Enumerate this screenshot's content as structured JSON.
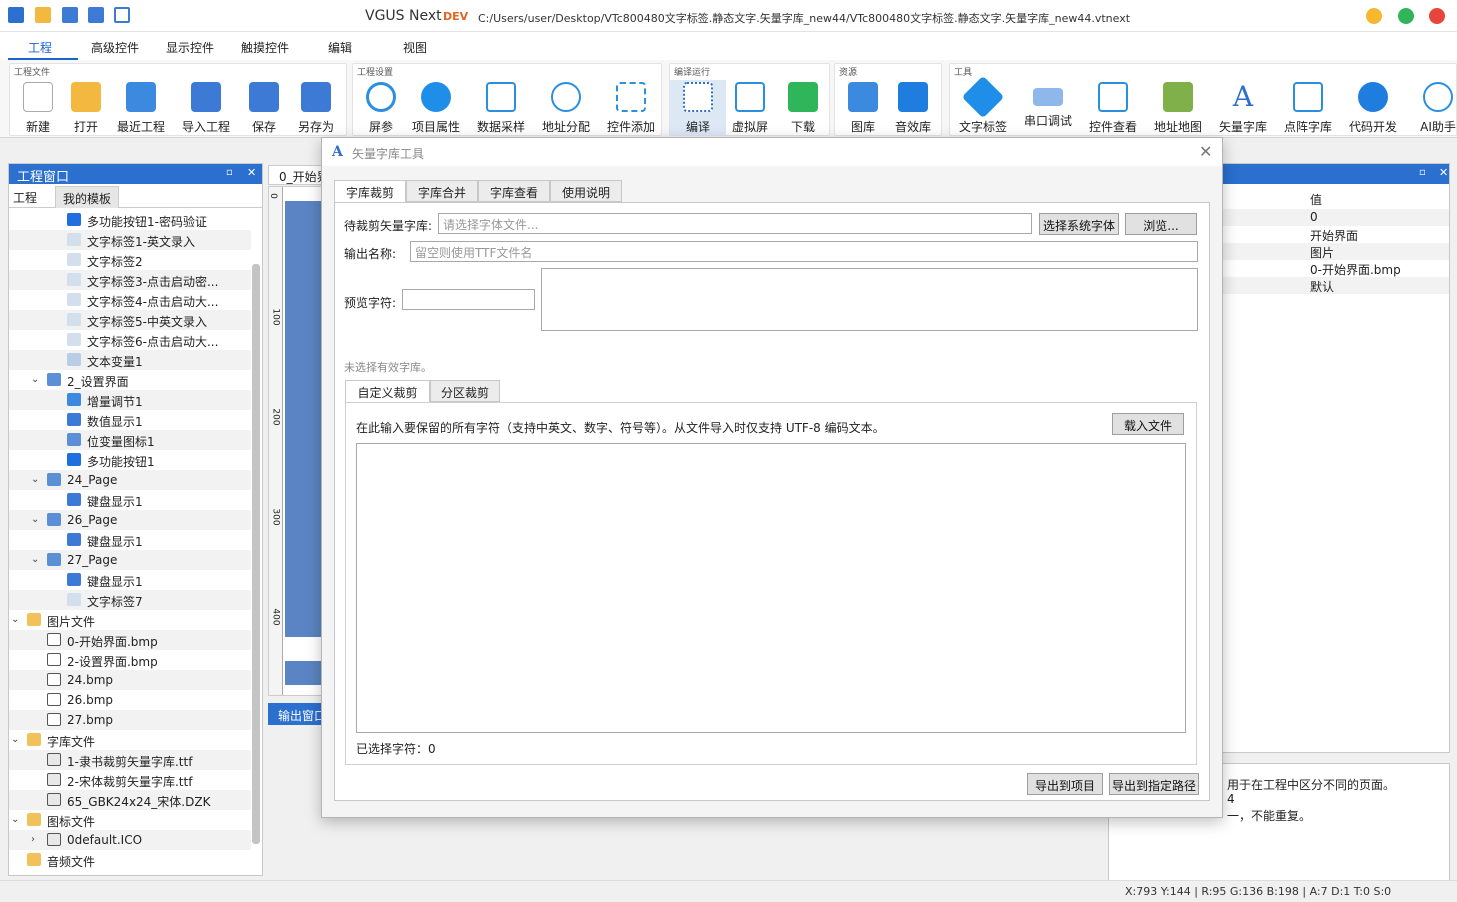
{
  "app": {
    "title": "VGUS Next",
    "edition": "DEV",
    "path": "C:/Users/user/Desktop/VTc800480文字标签.静态文字.矢量字库_new44/VTc800480文字标签.静态文字.矢量字库_new44.vtnext"
  },
  "menu": [
    "工程",
    "高级控件",
    "显示控件",
    "触摸控件",
    "编辑",
    "视图"
  ],
  "ribbon": {
    "groups": [
      {
        "label": "工程文件",
        "buttons": [
          "新建",
          "打开",
          "最近工程",
          "导入工程",
          "保存",
          "另存为"
        ]
      },
      {
        "label": "工程设置",
        "buttons": [
          "屏参",
          "项目属性",
          "数据采样",
          "地址分配",
          "控件添加"
        ]
      },
      {
        "label": "编译运行",
        "buttons": [
          "编译",
          "虚拟屏",
          "下载"
        ]
      },
      {
        "label": "资源",
        "buttons": [
          "图库",
          "音效库"
        ]
      },
      {
        "label": "工具",
        "buttons": [
          "文字标签",
          "串口调试",
          "控件查看",
          "地址地图",
          "矢量字库",
          "点阵字库",
          "代码开发",
          "AI助手"
        ]
      }
    ]
  },
  "project_panel": {
    "title": "工程窗口",
    "tabs": [
      "工程",
      "我的模板"
    ],
    "tree": [
      {
        "indent": 3,
        "icon": "button-icon",
        "label": "多功能按钮1-密码验证"
      },
      {
        "indent": 3,
        "icon": "text-icon",
        "label": "文字标签1-英文录入"
      },
      {
        "indent": 3,
        "icon": "text-icon",
        "label": "文字标签2"
      },
      {
        "indent": 3,
        "icon": "text-icon",
        "label": "文字标签3-点击启动密..."
      },
      {
        "indent": 3,
        "icon": "text-icon",
        "label": "文字标签4-点击启动大..."
      },
      {
        "indent": 3,
        "icon": "text-icon",
        "label": "文字标签5-中英文录入"
      },
      {
        "indent": 3,
        "icon": "text-icon",
        "label": "文字标签6-点击启动大..."
      },
      {
        "indent": 3,
        "icon": "variable-icon",
        "label": "文本变量1"
      },
      {
        "indent": 2,
        "icon": "page-icon",
        "label": "2_设置界面",
        "expand": "⌄"
      },
      {
        "indent": 3,
        "icon": "increment-icon",
        "label": "增量调节1"
      },
      {
        "indent": 3,
        "icon": "number-icon",
        "label": "数值显示1"
      },
      {
        "indent": 3,
        "icon": "bit-icon",
        "label": "位变量图标1"
      },
      {
        "indent": 3,
        "icon": "button-icon",
        "label": "多功能按钮1"
      },
      {
        "indent": 2,
        "icon": "page-icon",
        "label": "24_Page",
        "expand": "⌄"
      },
      {
        "indent": 3,
        "icon": "keyboard-icon",
        "label": "键盘显示1"
      },
      {
        "indent": 2,
        "icon": "page-icon",
        "label": "26_Page",
        "expand": "⌄"
      },
      {
        "indent": 3,
        "icon": "keyboard-icon",
        "label": "键盘显示1"
      },
      {
        "indent": 2,
        "icon": "page-icon",
        "label": "27_Page",
        "expand": "⌄"
      },
      {
        "indent": 3,
        "icon": "keyboard-icon",
        "label": "键盘显示1"
      },
      {
        "indent": 3,
        "icon": "text-icon",
        "label": "文字标签7"
      },
      {
        "indent": 1,
        "icon": "folder-icon",
        "label": "图片文件",
        "expand": "⌄"
      },
      {
        "indent": 2,
        "icon": "file-icon",
        "label": "0-开始界面.bmp"
      },
      {
        "indent": 2,
        "icon": "file-icon",
        "label": "2-设置界面.bmp"
      },
      {
        "indent": 2,
        "icon": "file-icon",
        "label": "24.bmp"
      },
      {
        "indent": 2,
        "icon": "file-icon",
        "label": "26.bmp"
      },
      {
        "indent": 2,
        "icon": "file-icon",
        "label": "27.bmp"
      },
      {
        "indent": 1,
        "icon": "folder-icon",
        "label": "字库文件",
        "expand": "⌄"
      },
      {
        "indent": 2,
        "icon": "font-file-icon",
        "label": "1-隶书裁剪矢量字库.ttf"
      },
      {
        "indent": 2,
        "icon": "font-file-icon",
        "label": "2-宋体裁剪矢量字库.ttf"
      },
      {
        "indent": 2,
        "icon": "font-file-icon",
        "label": "65_GBK24x24_宋体.DZK"
      },
      {
        "indent": 1,
        "icon": "folder-icon",
        "label": "图标文件",
        "expand": "⌄"
      },
      {
        "indent": 2,
        "icon": "icon-file-icon",
        "label": "0default.ICO",
        "expand": "›"
      },
      {
        "indent": 1,
        "icon": "folder-icon",
        "label": "音频文件"
      }
    ]
  },
  "canvas": {
    "tab": "0_开始界",
    "ruler": [
      "0",
      "100",
      "200",
      "300",
      "400"
    ],
    "output_tab": "输出窗口"
  },
  "properties": {
    "header": "值",
    "values": [
      "0",
      "开始界面",
      "图片",
      "0-开始界面.bmp",
      "默认"
    ],
    "description": [
      "用于在工程中区分不同的页面。",
      "4",
      "一，不能重复。"
    ]
  },
  "status": "X:793  Y:144  |  R:95 G:136 B:198  |  A:7  D:1  T:0  S:0",
  "dialog": {
    "title": "矢量字库工具",
    "tabs": [
      "字库裁剪",
      "字库合并",
      "字库查看",
      "使用说明"
    ],
    "source_label": "待裁剪矢量字库:",
    "source_placeholder": "请选择字体文件...",
    "system_font_button": "选择系统字体",
    "browse_button": "浏览...",
    "output_label": "输出名称:",
    "output_placeholder": "留空则使用TTF文件名",
    "preview_label": "预览字符:",
    "no_font_msg": "未选择有效字库。",
    "sub_tabs": [
      "自定义裁剪",
      "分区裁剪"
    ],
    "instruction": "在此输入要保留的所有字符（支持中英文、数字、符号等）。从文件导入时仅支持 UTF-8 编码文本。",
    "load_file_button": "载入文件",
    "selected_count": "已选择字符：0",
    "export_project_button": "导出到项目",
    "export_path_button": "导出到指定路径"
  }
}
